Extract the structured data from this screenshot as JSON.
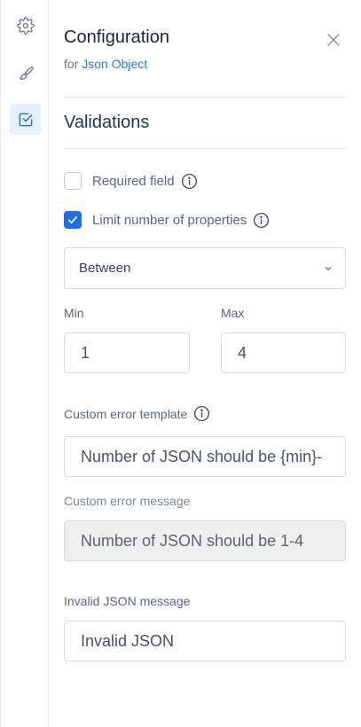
{
  "rail": {
    "items": [
      {
        "name": "settings",
        "active": false
      },
      {
        "name": "style",
        "active": false
      },
      {
        "name": "validations",
        "active": true
      }
    ]
  },
  "header": {
    "title": "Configuration",
    "subtitle_prefix": "for",
    "subtitle_link": "Json Object"
  },
  "validations": {
    "title": "Validations",
    "required_field": {
      "label": "Required field",
      "checked": false
    },
    "limit_properties": {
      "label": "Limit number of properties",
      "checked": true
    },
    "range_select": {
      "value": "Between"
    },
    "min": {
      "label": "Min",
      "value": "1"
    },
    "max": {
      "label": "Max",
      "value": "4"
    },
    "custom_error_template": {
      "label": "Custom error template",
      "value": "Number of JSON should be {min}-"
    },
    "custom_error_message": {
      "label": "Custom error message",
      "value": "Number of JSON should be 1-4"
    },
    "invalid_json_message": {
      "label": "Invalid JSON message",
      "value": "Invalid JSON"
    }
  },
  "colors": {
    "accent": "#1f6fe6",
    "link": "#1f7ae0",
    "active_rail_bg": "#e6f0fb",
    "section_title": "#1b3553"
  }
}
